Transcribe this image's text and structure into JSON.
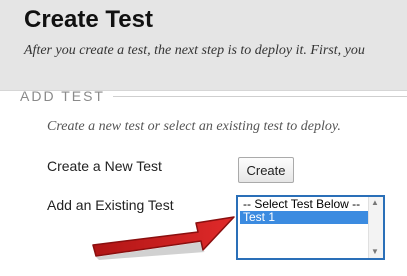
{
  "header": {
    "title": "Create Test",
    "description": "After you create a test, the next step is to deploy it. First, you"
  },
  "section": {
    "label": "ADD TEST",
    "instructions": "Create a new test or select an existing test to deploy."
  },
  "form": {
    "create_new_label": "Create a New Test",
    "create_button_label": "Create",
    "add_existing_label": "Add an Existing Test",
    "existing_tests": {
      "options": [
        "-- Select Test Below --",
        "Test 1"
      ],
      "selected_option": "Test 1"
    }
  },
  "annotation": {
    "arrow_color": "#d42020",
    "arrow_icon": "pointer-arrow-icon"
  },
  "colors": {
    "select_focus_border": "#2a6fb8",
    "selected_option_bg": "#3b8be0",
    "header_bg": "#e5e5e5"
  }
}
